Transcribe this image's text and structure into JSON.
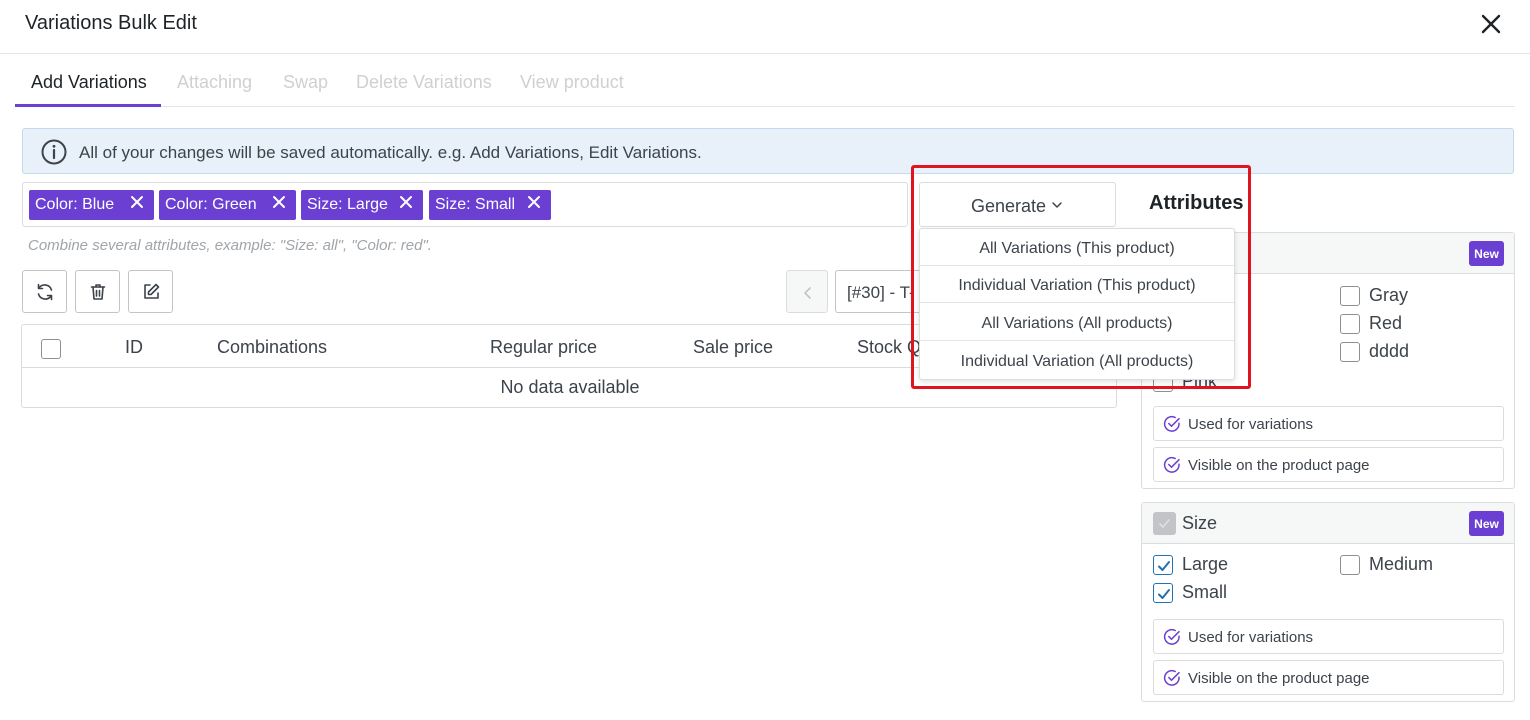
{
  "modal": {
    "title": "Variations Bulk Edit"
  },
  "tabs": [
    {
      "label": "Add Variations"
    },
    {
      "label": "Attaching"
    },
    {
      "label": "Swap"
    },
    {
      "label": "Delete Variations"
    },
    {
      "label": "View product"
    }
  ],
  "notice": {
    "text": "All of your changes will be saved automatically. e.g. Add Variations, Edit Variations."
  },
  "chips": [
    {
      "label": "Color: Blue"
    },
    {
      "label": "Color: Green"
    },
    {
      "label": "Size: Large"
    },
    {
      "label": "Size: Small"
    }
  ],
  "hint": "Combine several attributes, example: \"Size: all\", \"Color: red\".",
  "product_select": {
    "value": "[#30] - T-"
  },
  "table": {
    "headers": [
      "ID",
      "Combinations",
      "Regular price",
      "Sale price",
      "Stock Q"
    ],
    "empty_text": "No data available"
  },
  "generate": {
    "label": "Generate",
    "menu": [
      "All Variations (This product)",
      "Individual Variation (This product)",
      "All Variations (All products)",
      "Individual Variation (All products)"
    ]
  },
  "attributes": {
    "heading": "Attributes",
    "color_card": {
      "badge": "New",
      "options": [
        "Gray",
        "Red",
        "dddd",
        "Pink"
      ],
      "used_for_variations": "Used for variations",
      "visible_on_page": "Visible on the product page"
    },
    "size_card": {
      "title": "Size",
      "badge": "New",
      "options": [
        {
          "label": "Large",
          "checked": true
        },
        {
          "label": "Medium",
          "checked": false
        },
        {
          "label": "Small",
          "checked": true
        }
      ],
      "used_for_variations": "Used for variations",
      "visible_on_page": "Visible on the product page"
    }
  },
  "colors": {
    "accent": "#6a3fd1",
    "highlight": "#e0141e",
    "notice_bg": "#e8f1fa",
    "checkbox_blue": "#2271b1"
  }
}
